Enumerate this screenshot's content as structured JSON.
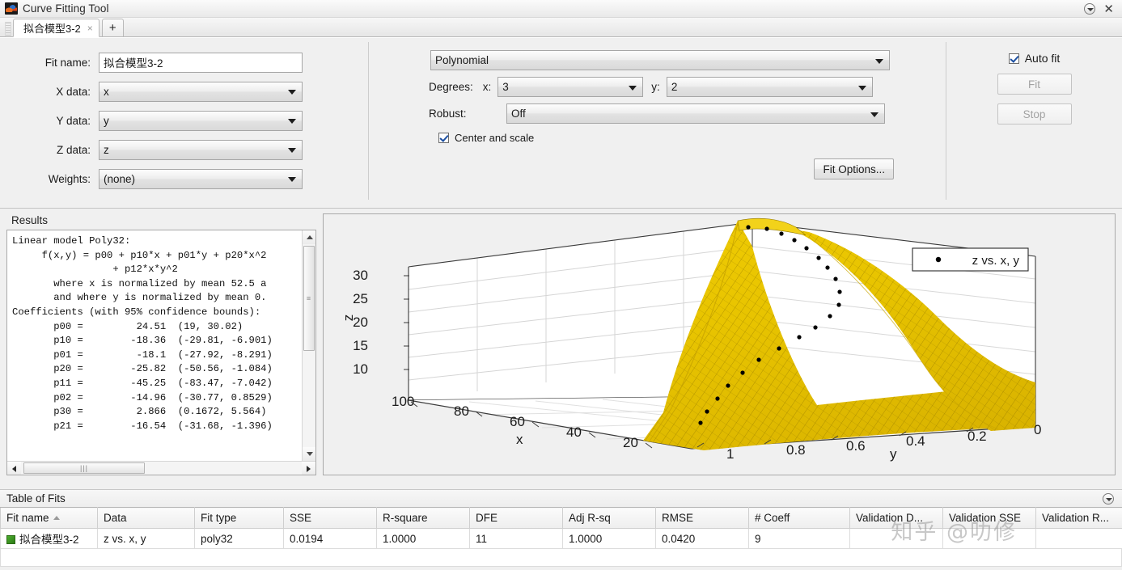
{
  "window": {
    "title": "Curve Fitting Tool",
    "app_icon": "matlab-icon",
    "minimize_icon": "dropdown-circle-icon",
    "close_icon": "close-icon"
  },
  "tabs": {
    "items": [
      {
        "label": "拟合模型3-2",
        "close": "×"
      }
    ],
    "add_label": "+"
  },
  "fit_form": {
    "fit_name_label": "Fit name:",
    "fit_name_value": "拟合模型3-2",
    "x_label": "X data:",
    "x_value": "x",
    "y_label": "Y data:",
    "y_value": "y",
    "z_label": "Z data:",
    "z_value": "z",
    "weights_label": "Weights:",
    "weights_value": "(none)"
  },
  "model": {
    "type_value": "Polynomial",
    "degrees_label": "Degrees:",
    "degree_x_label": "x:",
    "degree_x_value": "3",
    "degree_y_label": "y:",
    "degree_y_value": "2",
    "robust_label": "Robust:",
    "robust_value": "Off",
    "center_scale_label": "Center and scale",
    "center_scale_checked": true,
    "fit_options_label": "Fit Options..."
  },
  "actions": {
    "auto_fit_label": "Auto fit",
    "auto_fit_checked": true,
    "fit_label": "Fit",
    "stop_label": "Stop"
  },
  "results": {
    "title": "Results",
    "text": "Linear model Poly32:\n     f(x,y) = p00 + p10*x + p01*y + p20*x^2\n                 + p12*x*y^2\n       where x is normalized by mean 52.5 a\n       and where y is normalized by mean 0.\nCoefficients (with 95% confidence bounds):\n       p00 =         24.51  (19, 30.02)\n       p10 =        -18.36  (-29.81, -6.901)\n       p01 =         -18.1  (-27.92, -8.291)\n       p20 =        -25.82  (-50.56, -1.084)\n       p11 =        -45.25  (-83.47, -7.042)\n       p02 =        -14.96  (-30.77, 0.8529)\n       p30 =         2.866  (0.1672, 5.564)\n       p21 =        -16.54  (-31.68, -1.396)",
    "coefficients": [
      {
        "name": "p00",
        "value": "24.51",
        "ci": "(19, 30.02)"
      },
      {
        "name": "p10",
        "value": "-18.36",
        "ci": "(-29.81, -6.901)"
      },
      {
        "name": "p01",
        "value": "-18.1",
        "ci": "(-27.92, -8.291)"
      },
      {
        "name": "p20",
        "value": "-25.82",
        "ci": "(-50.56, -1.084)"
      },
      {
        "name": "p11",
        "value": "-45.25",
        "ci": "(-83.47, -7.042)"
      },
      {
        "name": "p02",
        "value": "-14.96",
        "ci": "(-30.77, 0.8529)"
      },
      {
        "name": "p30",
        "value": "2.866",
        "ci": "(0.1672, 5.564)"
      },
      {
        "name": "p21",
        "value": "-16.54",
        "ci": "(-31.68, -1.396)"
      }
    ]
  },
  "chart_data": {
    "type": "surface",
    "title": "",
    "xlabel": "x",
    "ylabel": "y",
    "zlabel": "z",
    "xlim": [
      0,
      100
    ],
    "ylim": [
      0,
      1
    ],
    "zlim": [
      5,
      32
    ],
    "xticks": [
      100,
      80,
      60,
      40,
      20
    ],
    "yticks": [
      1,
      0.8,
      0.6,
      0.4,
      0.2,
      0
    ],
    "zticks": [
      30,
      25,
      20,
      15,
      10
    ],
    "grid": true,
    "legend_position": "top-right",
    "legend": [
      {
        "label": "z vs. x, y",
        "marker": "dot",
        "color": "#000000"
      }
    ],
    "surface_color": "#e8c000",
    "surface_edge_color": "#8a7000",
    "marker_color": "#000000",
    "scatter_points": [
      [
        98,
        0.05,
        31.5
      ],
      [
        95,
        0.08,
        31.2
      ],
      [
        91,
        0.11,
        30.6
      ],
      [
        87,
        0.14,
        29.8
      ],
      [
        83,
        0.17,
        28.8
      ],
      [
        79,
        0.2,
        27.6
      ],
      [
        75,
        0.23,
        26.2
      ],
      [
        71,
        0.26,
        24.8
      ],
      [
        67,
        0.3,
        23.2
      ],
      [
        62,
        0.34,
        21.5
      ],
      [
        57,
        0.39,
        19.8
      ],
      [
        52,
        0.45,
        18.0
      ],
      [
        46,
        0.52,
        16.2
      ],
      [
        40,
        0.6,
        14.4
      ],
      [
        33,
        0.68,
        12.6
      ],
      [
        26,
        0.77,
        10.8
      ],
      [
        19,
        0.86,
        9.2
      ],
      [
        12,
        0.94,
        7.8
      ]
    ]
  },
  "table_of_fits": {
    "title": "Table of Fits",
    "collapse_icon": "collapse-icon",
    "columns": [
      "Fit name",
      "Data",
      "Fit type",
      "SSE",
      "R-square",
      "DFE",
      "Adj R-sq",
      "RMSE",
      "# Coeff",
      "Validation D...",
      "Validation SSE",
      "Validation R..."
    ],
    "sorted_column": "Fit name",
    "rows": [
      {
        "fit_name": "拟合模型3-2",
        "swatch_color": "#3d9b1e",
        "data": "z vs. x, y",
        "fit_type": "poly32",
        "sse": "0.0194",
        "r_square": "1.0000",
        "dfe": "11",
        "adj_r_sq": "1.0000",
        "rmse": "0.0420",
        "n_coeff": "9",
        "validation_data": "",
        "validation_sse": "",
        "validation_r": ""
      }
    ]
  },
  "watermark": {
    "text": "知乎 @叻修"
  }
}
